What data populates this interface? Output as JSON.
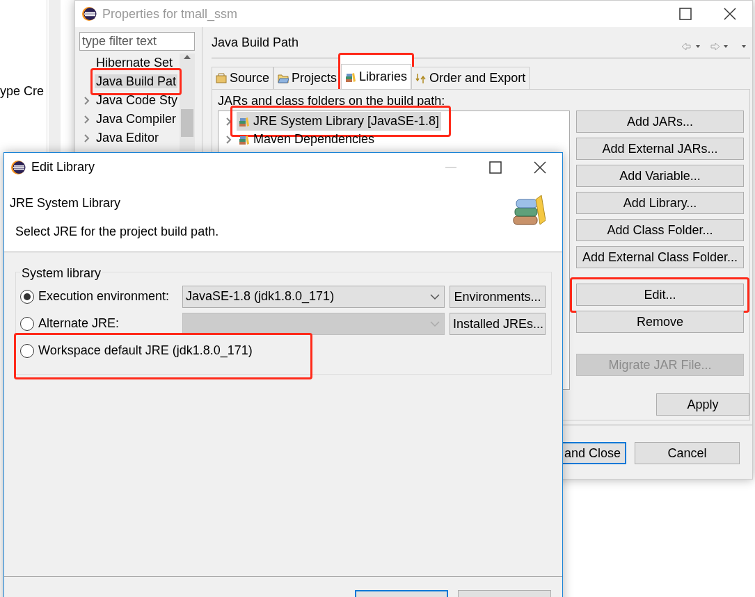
{
  "background_editor": {
    "text": "ype Cre"
  },
  "properties_window": {
    "title": "Properties for tmall_ssm",
    "active": false,
    "filter": {
      "placeholder": "type filter text"
    },
    "pages": [
      {
        "label": "Hibernate Set",
        "selected": false,
        "expandable": false,
        "highlighted": false
      },
      {
        "label": "Java Build Pat",
        "selected": true,
        "expandable": false,
        "highlighted": true
      },
      {
        "label": "Java Code Sty",
        "selected": false,
        "expandable": true,
        "highlighted": false
      },
      {
        "label": "Java Compiler",
        "selected": false,
        "expandable": true,
        "highlighted": false
      },
      {
        "label": "Java Editor",
        "selected": false,
        "expandable": true,
        "highlighted": false
      }
    ],
    "page_title": "Java Build Path",
    "tabs": [
      {
        "label": "Source",
        "selected": false,
        "highlighted": false
      },
      {
        "label": "Projects",
        "selected": false,
        "highlighted": false
      },
      {
        "label": "Libraries",
        "selected": true,
        "highlighted": true
      },
      {
        "label": "Order and Export",
        "selected": false,
        "highlighted": false
      }
    ],
    "list_label": "JARs and class folders on the build path:",
    "entries": [
      {
        "label": "JRE System Library [JavaSE-1.8]",
        "selected": true,
        "highlighted": true
      },
      {
        "label": "Maven Dependencies",
        "selected": false,
        "highlighted": false
      }
    ],
    "side_buttons": [
      {
        "label": "Add JARs...",
        "disabled": false,
        "highlighted": false
      },
      {
        "label": "Add External JARs...",
        "disabled": false,
        "highlighted": false
      },
      {
        "label": "Add Variable...",
        "disabled": false,
        "highlighted": false
      },
      {
        "label": "Add Library...",
        "disabled": false,
        "highlighted": false
      },
      {
        "label": "Add Class Folder...",
        "disabled": false,
        "highlighted": false
      },
      {
        "label": "Add External Class Folder...",
        "disabled": false,
        "highlighted": false
      },
      {
        "label": "Edit...",
        "disabled": false,
        "highlighted": true
      },
      {
        "label": "Remove",
        "disabled": false,
        "highlighted": false
      },
      {
        "label": "Migrate JAR File...",
        "disabled": true,
        "highlighted": false
      }
    ],
    "apply": "Apply",
    "footer_buttons": [
      {
        "label": "and Close",
        "default": true
      },
      {
        "label": "Cancel",
        "default": false
      }
    ]
  },
  "dialog": {
    "title": "Edit Library",
    "active": true,
    "heading": "JRE System Library",
    "description": "Select JRE for the project build path.",
    "group": "System library",
    "options": [
      {
        "kind": "combo",
        "label": "Execution environment:",
        "checked": true,
        "highlighted": false,
        "value": "JavaSE-1.8 (jdk1.8.0_171)",
        "disabled": false,
        "button": "Environments..."
      },
      {
        "kind": "combo",
        "label": "Alternate JRE:",
        "checked": false,
        "highlighted": false,
        "disabled": true,
        "button": "Installed JREs..."
      },
      {
        "kind": "plain",
        "label": "Workspace default JRE (jdk1.8.0_171)",
        "checked": false,
        "highlighted": true
      }
    ]
  }
}
